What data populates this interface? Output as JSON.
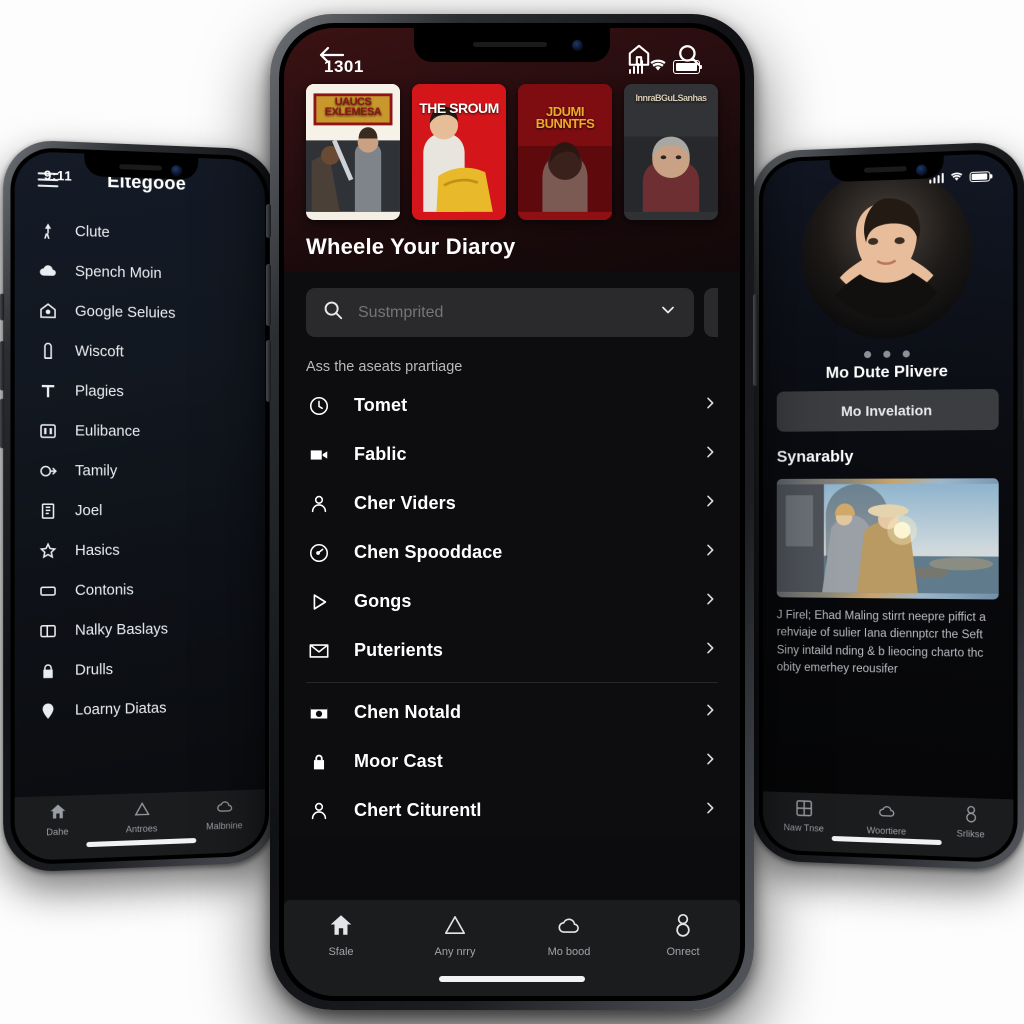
{
  "left_phone": {
    "status": {
      "time": "9:11"
    },
    "header": {
      "menu_icon": "hamburger-icon",
      "title": "Eltegooe"
    },
    "menu_items": [
      {
        "icon": "person-walk-icon",
        "label": "Clute"
      },
      {
        "icon": "cloud-icon",
        "label": "Spench Moin"
      },
      {
        "icon": "home-outline-icon",
        "label": "Google Seluies"
      },
      {
        "icon": "door-icon",
        "label": "Wiscoft"
      },
      {
        "icon": "text-t-icon",
        "label": "Plagies"
      },
      {
        "icon": "columns-icon",
        "label": "Eulibance"
      },
      {
        "icon": "logout-icon",
        "label": "Tamily"
      },
      {
        "icon": "book-icon",
        "label": "Joel"
      },
      {
        "icon": "star-icon",
        "label": "Hasics"
      },
      {
        "icon": "card-icon",
        "label": "Contonis"
      },
      {
        "icon": "layout-icon",
        "label": "Nalky Baslays"
      },
      {
        "icon": "lock-icon",
        "label": "Drulls"
      },
      {
        "icon": "pin-icon",
        "label": "Loarny Diatas"
      }
    ],
    "tabs": [
      {
        "icon": "home-icon",
        "label": "Dahe"
      },
      {
        "icon": "triangle-icon",
        "label": "Antroes"
      },
      {
        "icon": "cloud-icon",
        "label": "Malbnine"
      }
    ]
  },
  "center_phone": {
    "status": {
      "time": "1301",
      "signal": "signal-icon",
      "wifi": "wifi-icon",
      "battery": "battery-icon"
    },
    "topbar": {
      "back": "back-arrow-icon",
      "home": "home-outline-icon",
      "search": "search-icon"
    },
    "posters": [
      {
        "title": "UAUCS EXLEMESA",
        "accent": "#f0e3c2"
      },
      {
        "title": "THE SROUM",
        "accent": "#d4161a"
      },
      {
        "title": "JDUMI BUNNTFS",
        "accent": "#8f1013"
      },
      {
        "title": "InnraBGuLSanhas",
        "accent": "#3a3a3c"
      }
    ],
    "hero_title": "Wheele Your Diaroy",
    "search": {
      "icon": "search-icon",
      "value": "",
      "placeholder": "Sustmprited",
      "chevron": "chevron-down-icon"
    },
    "subtitle": "Ass the aseats prartiage",
    "list_group_1": [
      {
        "icon": "clock-icon",
        "label": "Tomet",
        "chevron": "chevron-right-icon"
      },
      {
        "icon": "video-icon",
        "label": "Fablic",
        "chevron": "chevron-right-icon"
      },
      {
        "icon": "person-icon",
        "label": "Cher Viders",
        "chevron": "chevron-right-icon"
      },
      {
        "icon": "speedometer-icon",
        "label": "Chen Spooddace",
        "chevron": "chevron-right-icon"
      },
      {
        "icon": "play-icon",
        "label": "Gongs",
        "chevron": "chevron-right-icon"
      },
      {
        "icon": "envelope-icon",
        "label": "Puterients",
        "chevron": "chevron-right-icon"
      }
    ],
    "list_group_2": [
      {
        "icon": "inbox-icon",
        "label": "Chen Notald",
        "chevron": "chevron-right-icon"
      },
      {
        "icon": "lock-icon",
        "label": "Moor Cast",
        "chevron": "chevron-right-icon"
      },
      {
        "icon": "person-icon",
        "label": "Chert Citurentl",
        "chevron": "chevron-right-icon"
      }
    ],
    "tabs": [
      {
        "icon": "home-icon",
        "label": "Sfale"
      },
      {
        "icon": "triangle-icon",
        "label": "Any nrry"
      },
      {
        "icon": "cloud-icon",
        "label": "Mo bood"
      },
      {
        "icon": "person-icon",
        "label": "Onrect"
      }
    ]
  },
  "right_phone": {
    "status": {
      "signal": "signal-icon",
      "wifi": "wifi-icon",
      "battery": "battery-icon"
    },
    "avatar": "avatar-portrait",
    "dots": 3,
    "name": "Mo Dute Plivere",
    "action_button": "Mo Invelation",
    "section_title": "Synarably",
    "card_image": "coastal-scene-image",
    "body_text": "J Firel; Ehad Maling stirrt neepre piffict a rehviaje of sulier Iana diennptcr the Seft Siny intaild nding & b lieocing charto thc obity emerhey reousifer",
    "tabs": [
      {
        "icon": "grid-icon",
        "label": "Naw Tnse"
      },
      {
        "icon": "cloud-icon",
        "label": "Woortiere"
      },
      {
        "icon": "person-icon",
        "label": "Srlikse"
      }
    ]
  },
  "colors": {
    "hero_red": "#3b1213",
    "panel": "#0d0d0f",
    "tabbar": "#1b1c1e",
    "search_field": "#2a2a2c",
    "left_bg": "#141a26"
  }
}
